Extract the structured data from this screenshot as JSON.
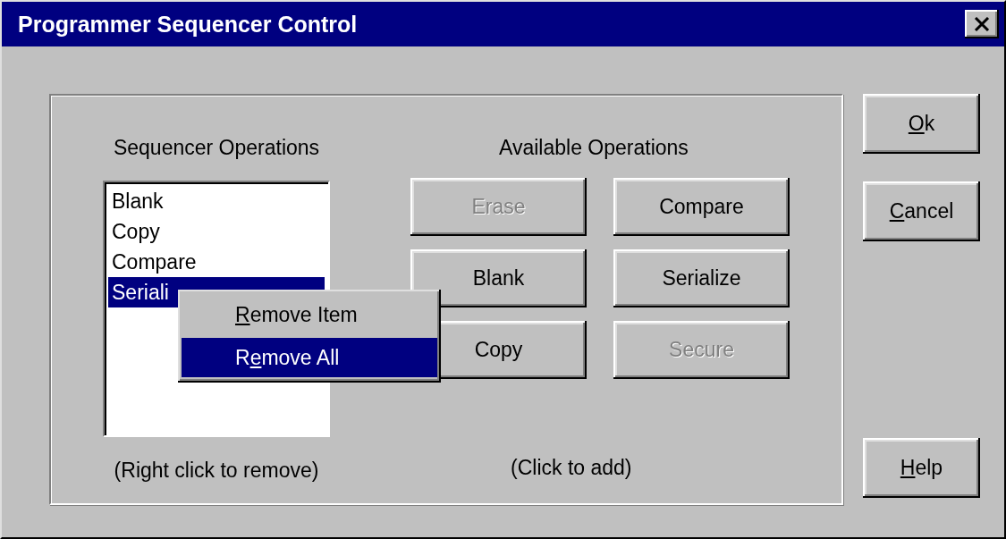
{
  "window": {
    "title": "Programmer Sequencer Control"
  },
  "sequencer": {
    "heading": "Sequencer Operations",
    "items": [
      {
        "label": "Blank",
        "selected": false
      },
      {
        "label": "Copy",
        "selected": false
      },
      {
        "label": "Compare",
        "selected": false
      },
      {
        "label": "Seriali",
        "selected": true
      }
    ],
    "hint": "(Right click to remove)"
  },
  "available": {
    "heading": "Available Operations",
    "buttons": [
      {
        "label": "Erase",
        "disabled": true
      },
      {
        "label": "Compare",
        "disabled": false
      },
      {
        "label": "Blank",
        "disabled": false
      },
      {
        "label": "Serialize",
        "disabled": false
      },
      {
        "label": "Copy",
        "disabled": false
      },
      {
        "label": "Secure",
        "disabled": true
      }
    ],
    "hint": "(Click to add)"
  },
  "context_menu": {
    "items": [
      {
        "key": "R",
        "after": "emove Item",
        "selected": false
      },
      {
        "before": "R",
        "key": "e",
        "after": "move All",
        "selected": true
      }
    ]
  },
  "dialog_buttons": [
    {
      "key": "O",
      "after": "k",
      "kind": "top"
    },
    {
      "key": "C",
      "after": "ancel",
      "kind": "top"
    },
    {
      "key": "H",
      "after": "elp",
      "kind": "bottom"
    }
  ]
}
